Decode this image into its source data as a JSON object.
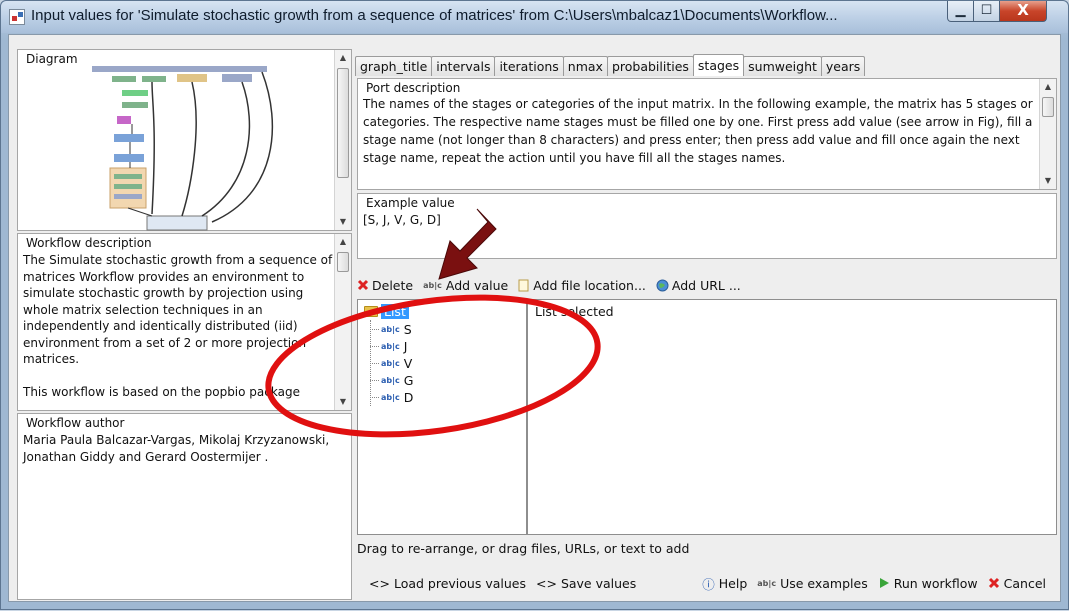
{
  "window": {
    "title": "Input values for 'Simulate stochastic growth from a sequence of matrices' from C:\\Users\\mbalcaz1\\Documents\\Workflow...",
    "min_glyph": "▁",
    "max_glyph": "☐",
    "close_glyph": "X"
  },
  "left": {
    "diagram_title": "Diagram",
    "workflow_description_title": "Workflow description",
    "workflow_description_text": "The Simulate stochastic growth from a sequence of matrices Workflow provides an environment to simulate stochastic growth by projection using whole matrix selection techniques in an independently and identically distributed (iid) environment from a set of 2 or more projection matrices.",
    "workflow_description_text2": "This workflow is based on the popbio package",
    "workflow_author_title": "Workflow author",
    "workflow_author_text": "Maria Paula Balcazar-Vargas, Mikolaj Krzyzanowski, Jonathan Giddy and Gerard Oostermijer ."
  },
  "tabs": [
    {
      "label": "graph_title",
      "active": false
    },
    {
      "label": "intervals",
      "active": false
    },
    {
      "label": "iterations",
      "active": false
    },
    {
      "label": "nmax",
      "active": false
    },
    {
      "label": "probabilities",
      "active": false
    },
    {
      "label": "stages",
      "active": true
    },
    {
      "label": "sumweight",
      "active": false
    },
    {
      "label": "years",
      "active": false
    }
  ],
  "port": {
    "title": "Port description",
    "text": "The names of the stages or categories of the input matrix. In the following example, the matrix has 5 stages or categories. The respective name stages must be filled one by one. First press add value (see arrow in Fig), fill a stage name (not longer than 8 characters) and press enter; then press add value and fill once again the next stage name, repeat the action until you have fill all the stages names."
  },
  "example": {
    "title": "Example value",
    "value": "[S, J, V, G, D]"
  },
  "toolbar": {
    "delete": "Delete",
    "add_value": "Add value",
    "add_file": "Add file location...",
    "add_url": "Add URL ..."
  },
  "tree": {
    "root": "List",
    "items": [
      "S",
      "J",
      "V",
      "G",
      "D"
    ],
    "item_icon": "ab|c"
  },
  "detail": {
    "text": "List selected"
  },
  "hint": "Drag to re-arrange, or drag files, URLs, or text to add",
  "bottom": {
    "load": "Load previous values",
    "save": "Save values",
    "help": "Help",
    "use_examples": "Use examples",
    "run": "Run workflow",
    "cancel": "Cancel",
    "load_glyph": "<>",
    "save_glyph": "<>",
    "help_glyph": "ⓘ"
  },
  "annotation": {
    "arrow_color": "#7a1010",
    "circle_color": "#e01010"
  }
}
